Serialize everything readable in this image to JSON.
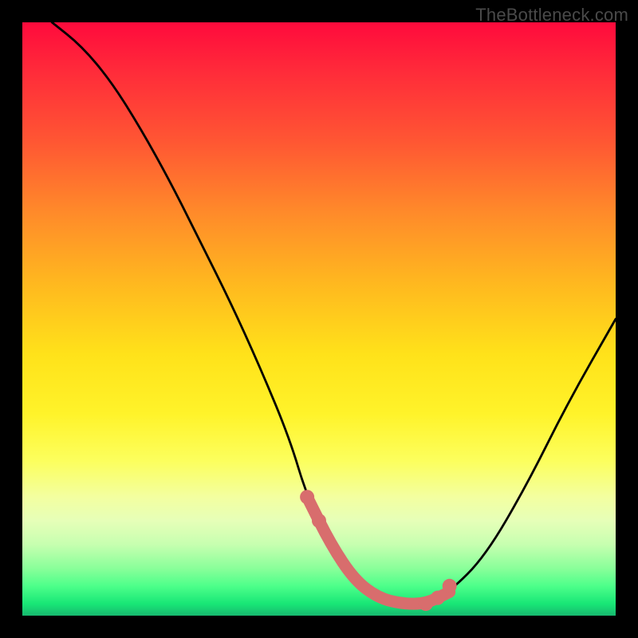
{
  "watermark": "TheBottleneck.com",
  "chart_data": {
    "type": "line",
    "title": "",
    "xlabel": "",
    "ylabel": "",
    "xlim": [
      0,
      100
    ],
    "ylim": [
      0,
      100
    ],
    "background_gradient": {
      "top_color": "#ff0a3c",
      "bottom_color": "#17b86f",
      "meaning": "red=high bottleneck, green=low bottleneck"
    },
    "series": [
      {
        "name": "bottleneck-curve",
        "color": "#000000",
        "x": [
          5,
          10,
          15,
          20,
          25,
          30,
          35,
          40,
          45,
          48,
          52,
          56,
          60,
          64,
          68,
          72,
          78,
          85,
          92,
          100
        ],
        "y": [
          100,
          96,
          90,
          82,
          73,
          63,
          53,
          42,
          30,
          20,
          12,
          6,
          3,
          2,
          2,
          4,
          10,
          22,
          36,
          50
        ]
      }
    ],
    "highlight": {
      "name": "optimal-range",
      "color": "#d86d6d",
      "x": [
        48,
        52,
        56,
        60,
        64,
        68,
        72
      ],
      "y": [
        20,
        12,
        6,
        3,
        2,
        2,
        4
      ],
      "dots_x": [
        48,
        50,
        68,
        70,
        72
      ],
      "dots_y": [
        20,
        16,
        2,
        3,
        5
      ]
    }
  }
}
